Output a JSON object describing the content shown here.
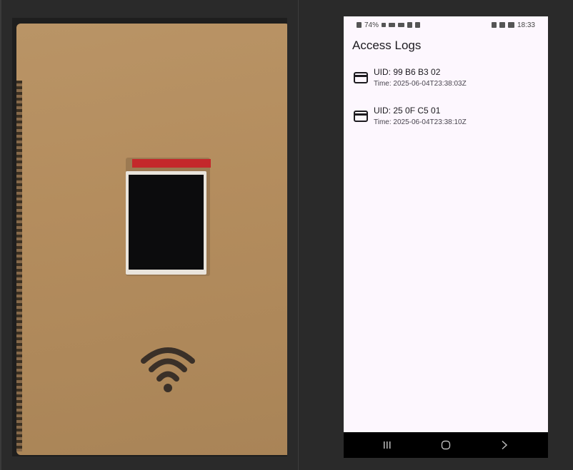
{
  "status_bar": {
    "battery": "74%",
    "time": "18:33"
  },
  "app": {
    "title": "Access Logs",
    "logs": [
      {
        "uid": "UID: 99 B6 B3 02",
        "time": "Time: 2025-06-04T23:38:03Z"
      },
      {
        "uid": "UID: 25 0F C5 01",
        "time": "Time: 2025-06-04T23:38:10Z"
      }
    ]
  },
  "navigation": {
    "recents_icon": "recents-icon",
    "home_icon": "home-icon",
    "back_icon": "back-icon"
  },
  "colors": {
    "app_background": "#fdf7fe",
    "text_primary": "#1d1b20",
    "text_secondary": "#49454f",
    "navbar": "#000000",
    "cardboard": "#b48d5e",
    "pcb": "#c4282b"
  }
}
